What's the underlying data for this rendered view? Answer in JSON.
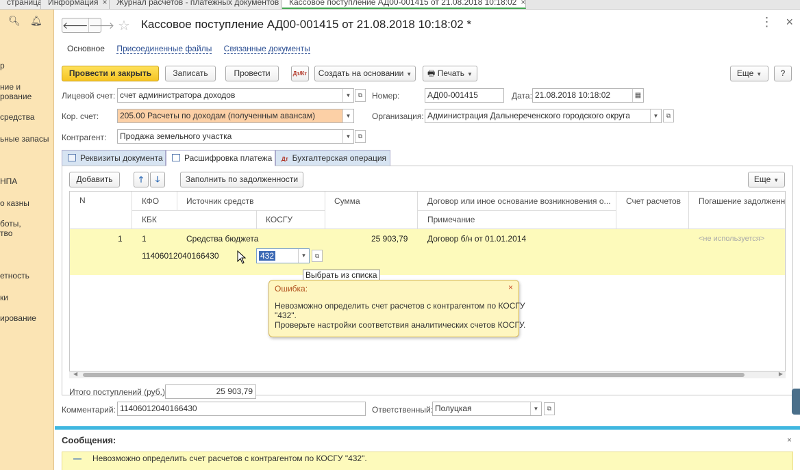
{
  "window_tabs": [
    {
      "label": "страница",
      "close": ""
    },
    {
      "label": "Информация",
      "close": "×"
    },
    {
      "label": "Журнал расчетов - платежных документов",
      "close": "×"
    },
    {
      "label": "Кассовое поступление АД00-001415 от 21.08.2018 10:18:02",
      "close": "×"
    }
  ],
  "sidebar": {
    "items": [
      "р",
      "ние и",
      "рование",
      "средства",
      "ьные запасы",
      "НПА",
      "о казны",
      "боты,",
      "тво",
      "етность",
      "ки",
      "ирование"
    ]
  },
  "header": {
    "title": "Кассовое поступление АД00-001415 от 21.08.2018 10:18:02 *",
    "nav_back": "🡐",
    "nav_forward": "🡒",
    "star": "☆",
    "more": "⋮",
    "close": "×"
  },
  "subnav": {
    "main": "Основное",
    "attached": "Присоединенные файлы",
    "related": "Связанные документы"
  },
  "toolbar": {
    "post_close": "Провести и закрыть",
    "save": "Записать",
    "post": "Провести",
    "dtkt": "Дт/Кт",
    "create_based": "Создать на основании",
    "print": "Печать",
    "more": "Еще",
    "help": "?"
  },
  "fields": {
    "account_label": "Лицевой счет:",
    "account_value": "счет администратора доходов",
    "corr_label": "Кор. счет:",
    "corr_value": "205.00 Расчеты по доходам (полученным авансам)",
    "counterparty_label": "Контрагент:",
    "counterparty_value": "Продажа земельного участка",
    "number_label": "Номер:",
    "number_value": "АД00-001415",
    "date_label": "Дата:",
    "date_value": "21.08.2018 10:18:02",
    "org_label": "Организация:",
    "org_value": "Администрация Дальнереченского городского округа"
  },
  "doc_tabs": {
    "requisites": "Реквизиты документа",
    "decoding": "Расшифровка платежа",
    "accounting": "Бухгалтерская операция"
  },
  "table_toolbar": {
    "add": "Добавить",
    "up": "🡑",
    "down": "🡓",
    "fill": "Заполнить по задолженности",
    "more": "Еще"
  },
  "table": {
    "headers": {
      "n": "N",
      "kfo": "КФО",
      "source": "Источник средств",
      "kbk": "КБК",
      "kosgu": "КОСГУ",
      "sum": "Сумма",
      "contract": "Договор или иное основание возникновения о...",
      "note": "Примечание",
      "settle_account": "Счет расчетов",
      "debt_repayment": "Погашение задолженно"
    },
    "row": {
      "n": "1",
      "kfo": "1",
      "source": "Средства бюджета",
      "kbk": "11406012040166430",
      "kosgu": "432",
      "sum": "25 903,79",
      "contract": "Договор б/н от 01.01.2014",
      "debt_repayment": "<не используется>"
    },
    "tooltip": "Выбрать из списка"
  },
  "error_balloon": {
    "title": "Ошибка:",
    "line1": "Невозможно определить счет расчетов с контрагентом по КОСГУ",
    "line2": "\"432\".",
    "line3": "Проверьте настройки соответствия аналитических счетов КОСГУ.",
    "close": "×"
  },
  "totals": {
    "label": "Итого поступлений (руб.):",
    "value": "25 903,79"
  },
  "bottom": {
    "comment_label": "Комментарий:",
    "comment_value": "11406012040166430",
    "responsible_label": "Ответственный:",
    "responsible_value": "Полуцкая"
  },
  "messages": {
    "header": "Сообщения:",
    "close": "×",
    "mark": "—",
    "line1": "Невозможно определить счет расчетов с контрагентом по КОСГУ \"432\"."
  },
  "colors": {
    "sidebar": "#fbe4b4",
    "primary_button": "#f5c422",
    "orange_field": "#fcd0a6",
    "selected_row": "#fdfabb",
    "messages_bar": "#3fb7e0"
  }
}
